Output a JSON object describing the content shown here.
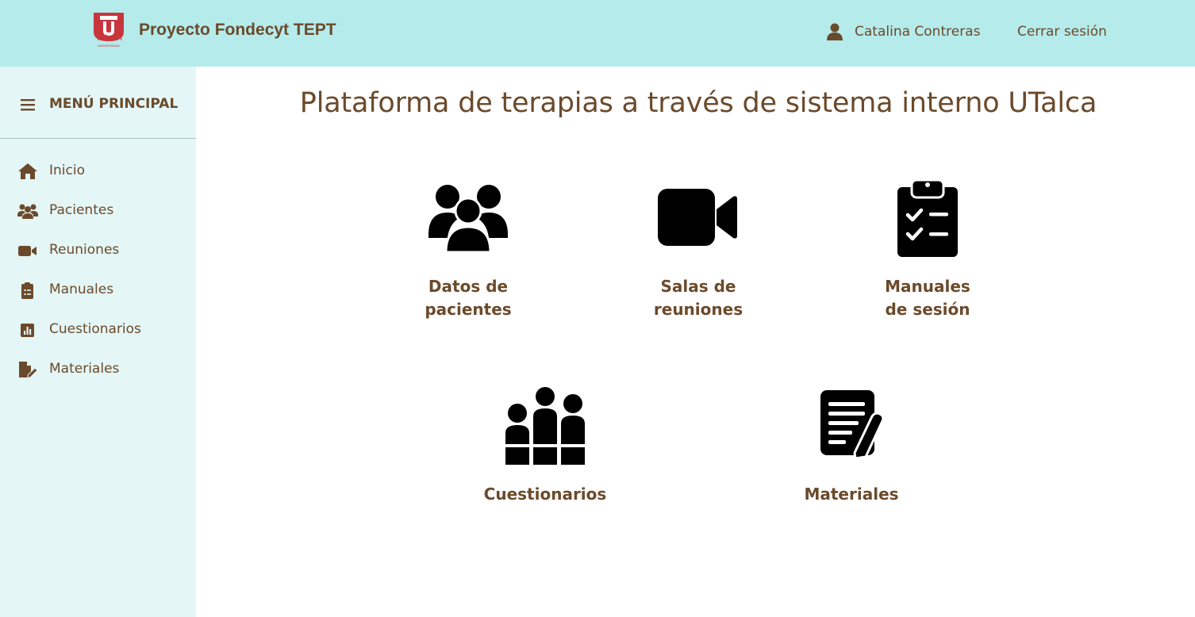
{
  "header": {
    "logo_text": "TALCA",
    "logo_subtext": "UNIVERSIDAD",
    "brand": "Proyecto Fondecyt TEPT",
    "user_name": "Catalina Contreras",
    "logout_label": "Cerrar sesión"
  },
  "sidebar": {
    "title": "MENÚ PRINCIPAL",
    "items": [
      {
        "label": "Inicio",
        "icon": "home-icon"
      },
      {
        "label": "Pacientes",
        "icon": "users-icon"
      },
      {
        "label": "Reuniones",
        "icon": "video-icon"
      },
      {
        "label": "Manuales",
        "icon": "clipboard-icon"
      },
      {
        "label": "Cuestionarios",
        "icon": "chart-icon"
      },
      {
        "label": "Materiales",
        "icon": "file-edit-icon"
      }
    ]
  },
  "main": {
    "title": "Plataforma de terapias a través de sistema interno UTalca",
    "cards": [
      {
        "label": "Datos de\npacientes",
        "icon": "users-icon"
      },
      {
        "label": "Salas de\nreuniones",
        "icon": "video-icon"
      },
      {
        "label": "Manuales\nde sesión",
        "icon": "clipboard-check-icon"
      },
      {
        "label": "Cuestionarios",
        "icon": "poll-people-icon"
      },
      {
        "label": "Materiales",
        "icon": "file-signature-icon"
      }
    ]
  },
  "colors": {
    "header_bg": "#b5ebeb",
    "sidebar_bg": "#e4f6f6",
    "text": "#6b4a2b",
    "logo_red": "#c8363d"
  }
}
